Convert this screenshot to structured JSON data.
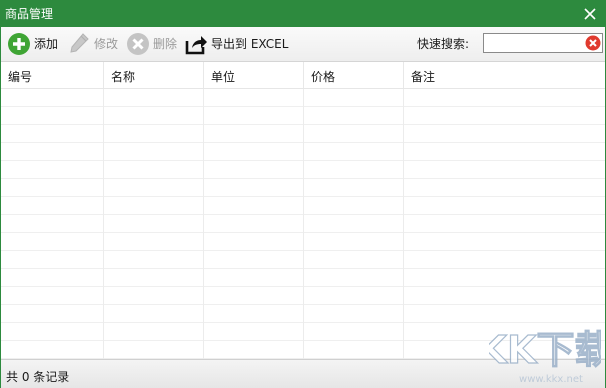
{
  "window": {
    "title": "商品管理"
  },
  "toolbar": {
    "add_label": "添加",
    "edit_label": "修改",
    "delete_label": "删除",
    "export_label": "导出到 EXCEL",
    "search_label": "快速搜索:",
    "search_value": "",
    "search_placeholder": ""
  },
  "grid": {
    "columns": [
      "编号",
      "名称",
      "单位",
      "价格",
      "备注"
    ],
    "rows": []
  },
  "status": {
    "text": "共 0 条记录"
  },
  "watermark": {
    "brand": "KK下载",
    "url": "www.kkx.net"
  },
  "colors": {
    "title_bar": "#2d8a3e",
    "add_icon": "#3fa535",
    "clear_icon": "#e03a2e"
  }
}
